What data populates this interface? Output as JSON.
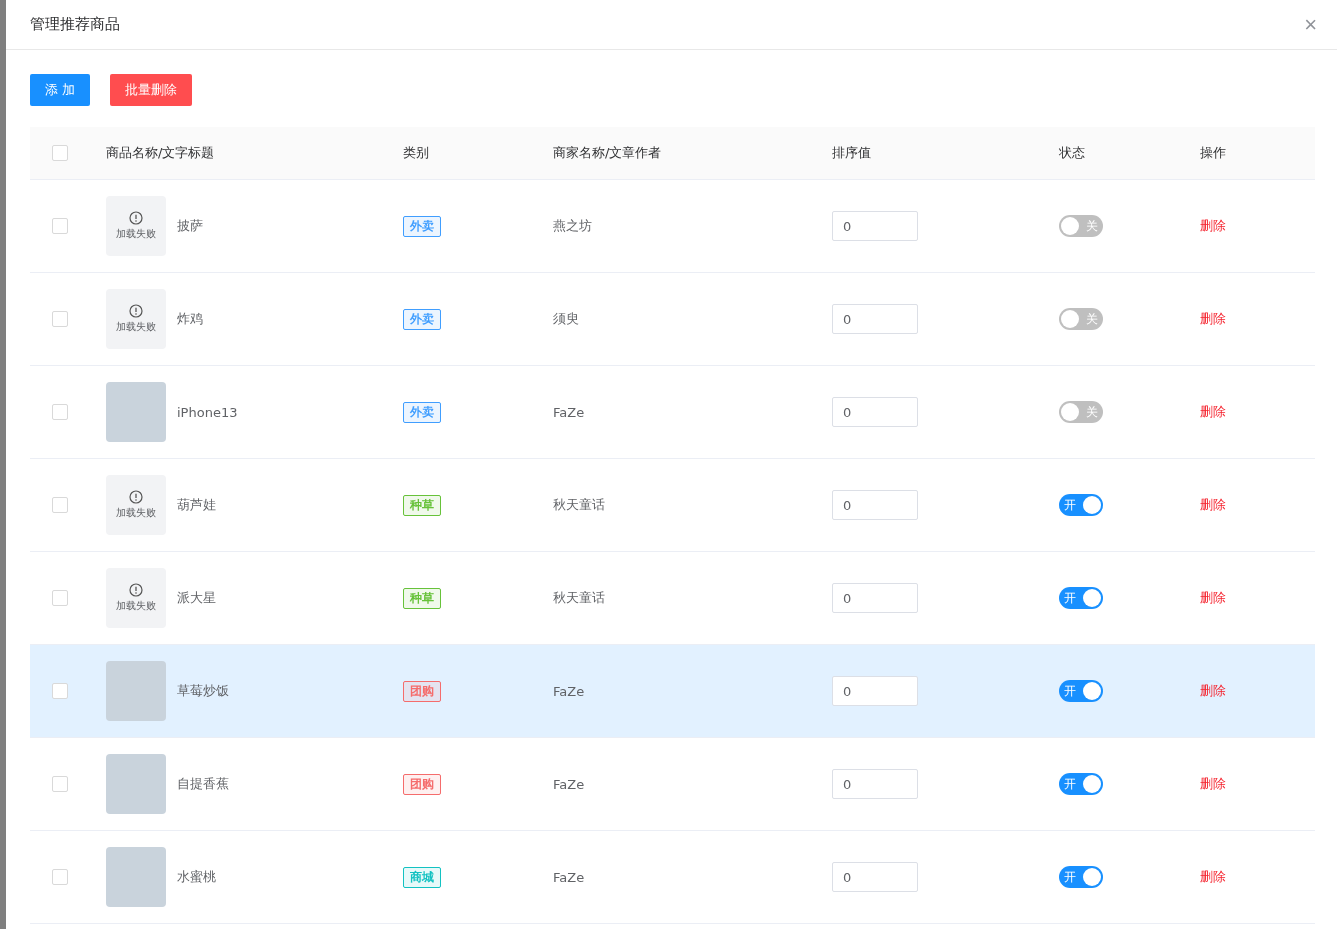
{
  "dialog": {
    "title": "管理推荐商品",
    "close": "×"
  },
  "toolbar": {
    "add_button": "添 加",
    "batch_delete_button": "批量删除"
  },
  "table": {
    "select_all": {
      "checked": false
    },
    "columns": [
      "商品名称/文字标题",
      "类别",
      "商家名称/文章作者",
      "排序值",
      "状态",
      "操作"
    ],
    "rows": [
      {
        "checked": false,
        "hovered": false,
        "image": {
          "kind": "error",
          "text": "加载失败"
        },
        "name": "披萨",
        "category": {
          "text": "外卖",
          "color": "#409eff"
        },
        "merchant": "燕之坊",
        "sort": "0",
        "status": {
          "on": false,
          "text": "关"
        },
        "action": "删除"
      },
      {
        "checked": false,
        "hovered": false,
        "image": {
          "kind": "error",
          "text": "加载失败"
        },
        "name": "炸鸡",
        "category": {
          "text": "外卖",
          "color": "#409eff"
        },
        "merchant": "须臾",
        "sort": "0",
        "status": {
          "on": false,
          "text": "关"
        },
        "action": "删除"
      },
      {
        "checked": false,
        "hovered": false,
        "image": {
          "kind": "photo"
        },
        "name": "iPhone13",
        "category": {
          "text": "外卖",
          "color": "#409eff"
        },
        "merchant": "FaZe",
        "sort": "0",
        "status": {
          "on": false,
          "text": "关"
        },
        "action": "删除"
      },
      {
        "checked": false,
        "hovered": false,
        "image": {
          "kind": "error",
          "text": "加载失败"
        },
        "name": "葫芦娃",
        "category": {
          "text": "种草",
          "color": "#67c23a"
        },
        "merchant": "秋天童话",
        "sort": "0",
        "status": {
          "on": true,
          "text": "开"
        },
        "action": "删除"
      },
      {
        "checked": false,
        "hovered": false,
        "image": {
          "kind": "error",
          "text": "加载失败"
        },
        "name": "派大星",
        "category": {
          "text": "种草",
          "color": "#67c23a"
        },
        "merchant": "秋天童话",
        "sort": "0",
        "status": {
          "on": true,
          "text": "开"
        },
        "action": "删除"
      },
      {
        "checked": false,
        "hovered": true,
        "image": {
          "kind": "photo"
        },
        "name": "草莓炒饭",
        "category": {
          "text": "团购",
          "color": "#f56c6c"
        },
        "merchant": "FaZe",
        "sort": "0",
        "status": {
          "on": true,
          "text": "开"
        },
        "action": "删除"
      },
      {
        "checked": false,
        "hovered": false,
        "image": {
          "kind": "photo"
        },
        "name": "自提香蕉",
        "category": {
          "text": "团购",
          "color": "#f56c6c"
        },
        "merchant": "FaZe",
        "sort": "0",
        "status": {
          "on": true,
          "text": "开"
        },
        "action": "删除"
      },
      {
        "checked": false,
        "hovered": false,
        "image": {
          "kind": "photo"
        },
        "name": "水蜜桃",
        "category": {
          "text": "商城",
          "color": "#13c2c2"
        },
        "merchant": "FaZe",
        "sort": "0",
        "status": {
          "on": true,
          "text": "开"
        },
        "action": "删除"
      }
    ]
  }
}
